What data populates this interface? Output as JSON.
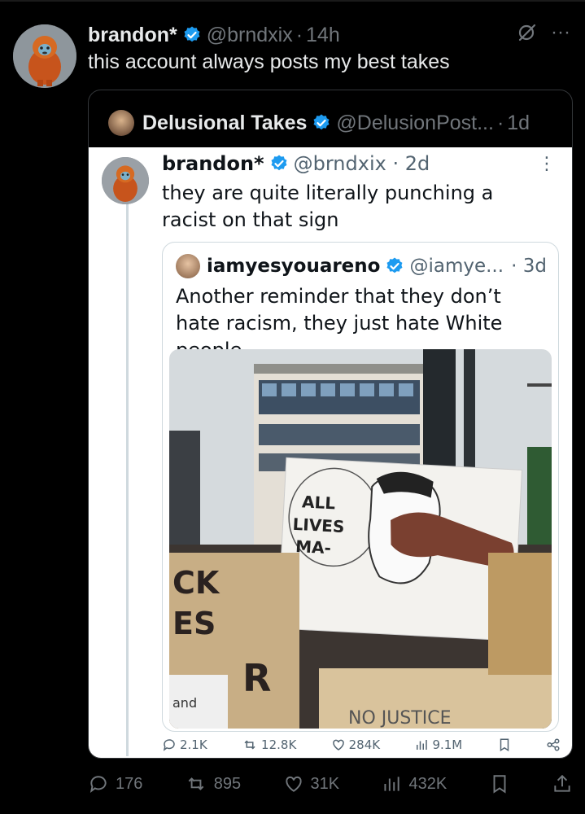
{
  "post": {
    "name": "brandon*",
    "handle": "@brndxix",
    "time": "14h",
    "text": "this account always posts my best takes",
    "actions": {
      "replies": "176",
      "reposts": "895",
      "likes": "31K",
      "views": "432K"
    }
  },
  "quoted": {
    "name": "Delusional Takes",
    "handle": "@DelusionPost...",
    "time": "1d"
  },
  "screenshot": {
    "name": "brandon*",
    "handle": "@brndxix",
    "time": "2d",
    "text": "they are quite literally punching a racist on that sign",
    "inner": {
      "name": "iamyesyouareno",
      "handle": "@iamye...",
      "time": "3d",
      "text": "Another reminder that they don’t hate racism, they just hate White people.",
      "sign_text": "ALL LIVES MA-",
      "sign_bottom": "NO JUSTICE",
      "sign_left_1": "CK",
      "sign_left_2": "ES",
      "sign_left_3": "R",
      "sign_small": "and"
    },
    "actions": {
      "replies": "2.1K",
      "reposts": "12.8K",
      "likes": "284K",
      "views": "9.1M"
    }
  },
  "colors": {
    "verified": "#1d9bf0",
    "muted_dark": "#71767b",
    "muted_light": "#536471"
  }
}
